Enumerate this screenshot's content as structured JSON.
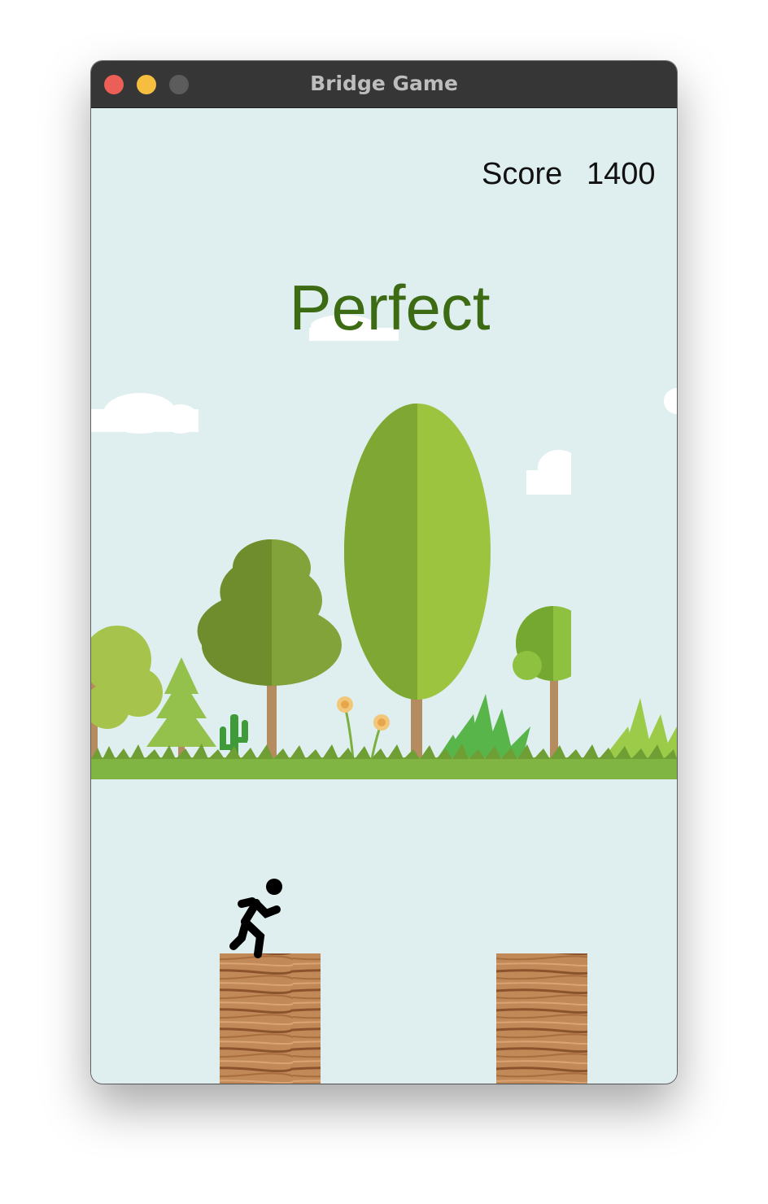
{
  "window": {
    "title": "Bridge Game"
  },
  "hud": {
    "score_label": "Score",
    "score_value": "1400",
    "message": "Perfect"
  },
  "colors": {
    "sky": "#dfeeef",
    "message": "#3c6b14",
    "grass": "#7cb342",
    "wood": "#b77a4a",
    "titlebar": "#363636"
  },
  "icons": {
    "close": "close-icon",
    "minimize": "minimize-icon",
    "maximize": "maximize-icon"
  }
}
